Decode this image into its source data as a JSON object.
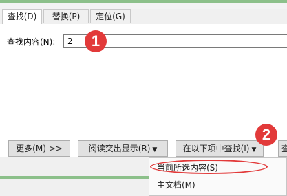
{
  "tabs": [
    {
      "label": "查找(D)",
      "selected": true
    },
    {
      "label": "替换(P)",
      "selected": false
    },
    {
      "label": "定位(G)",
      "selected": false
    }
  ],
  "find": {
    "label": "查找内容(N):",
    "value": "2"
  },
  "annotations": {
    "step1": "1",
    "step2": "2"
  },
  "buttons": {
    "more": "更多(M) >>",
    "reading_highlight": "阅读突出显示(R)",
    "find_in": "在以下项中查找(I)",
    "find_next": "查"
  },
  "dropdown": {
    "items": [
      {
        "label": "当前所选内容(S)",
        "highlighted": true
      },
      {
        "label": "主文档(M)",
        "highlighted": false
      }
    ]
  },
  "colors": {
    "accent_green": "#8cc08a",
    "annotation_red": "#e23a3a"
  }
}
